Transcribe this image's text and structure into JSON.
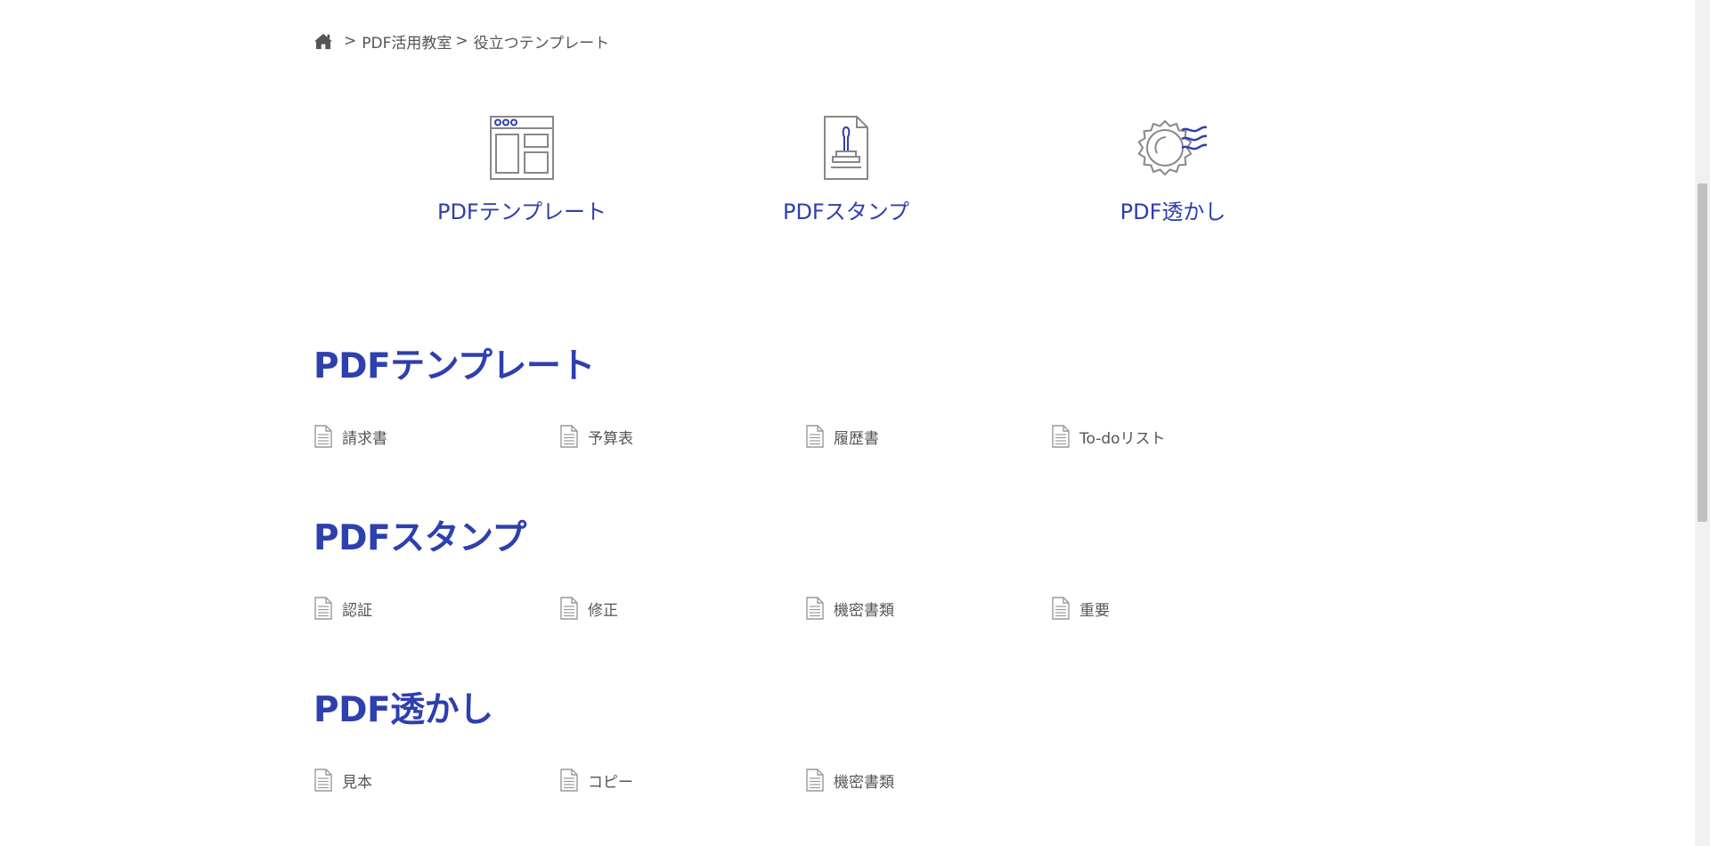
{
  "breadcrumb": {
    "home_icon": "home-icon",
    "separator": ">",
    "link": "PDF活用教室",
    "current": "役立つテンプレート"
  },
  "tiles": [
    {
      "label": "PDFテンプレート",
      "icon": "template-layout-icon"
    },
    {
      "label": "PDFスタンプ",
      "icon": "stamp-document-icon"
    },
    {
      "label": "PDF透かし",
      "icon": "watermark-seal-icon"
    }
  ],
  "sections": [
    {
      "title": "PDFテンプレート",
      "items": [
        "請求書",
        "予算表",
        "履歴書",
        "To-doリスト"
      ]
    },
    {
      "title": "PDFスタンプ",
      "items": [
        "認証",
        "修正",
        "機密書類",
        "重要"
      ]
    },
    {
      "title": "PDF透かし",
      "items": [
        "見本",
        "コピー",
        "機密書類"
      ]
    }
  ],
  "colors": {
    "accent": "#2e3fae",
    "text": "#555555",
    "icon_gray": "#888888"
  }
}
